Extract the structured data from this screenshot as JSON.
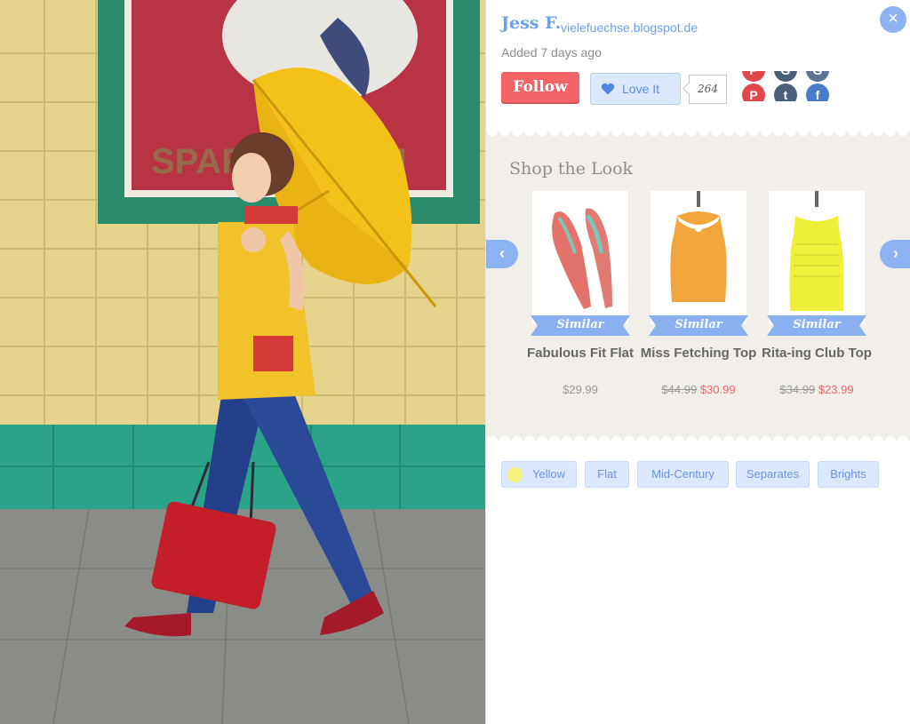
{
  "user": {
    "name": "Jess F.",
    "blog": "vielefuechse.blogspot.de",
    "added": "Added 7 days ago"
  },
  "actions": {
    "follow_label": "Follow",
    "love_label": "Love It",
    "love_count": "264",
    "close_label": "×"
  },
  "share": [
    {
      "name": "pinterest-icon",
      "glyph": "P",
      "color": "#e0474c"
    },
    {
      "name": "google-plus-icon",
      "glyph": "G",
      "color": "#4a5f79"
    },
    {
      "name": "google-plus-icon",
      "glyph": "G",
      "color": "#5b7494"
    },
    {
      "name": "pinterest-icon",
      "glyph": "P",
      "color": "#e0474c"
    },
    {
      "name": "tumblr-icon",
      "glyph": "t",
      "color": "#4a5f79"
    },
    {
      "name": "facebook-icon",
      "glyph": "f",
      "color": "#4a7dc9"
    }
  ],
  "shop": {
    "title": "Shop the Look",
    "prev_label": "‹",
    "next_label": "›",
    "similar_label": "Similar",
    "products": [
      {
        "name": "Fabulous Fit Flat",
        "old_price": "",
        "price": "$29.99",
        "image": "coral-flat-shoe"
      },
      {
        "name": "Miss Fetching Top",
        "old_price": "$44.99",
        "price": "$30.99",
        "image": "mustard-top"
      },
      {
        "name": "Rita-ing Club Top",
        "old_price": "$34.99",
        "price": "$23.99",
        "image": "lime-top"
      }
    ]
  },
  "tags": [
    "Yellow",
    "Flat",
    "Mid-Century",
    "Separates",
    "Brights"
  ],
  "colors": {
    "accent_blue": "#6d9ef0",
    "follow_red": "#f26467",
    "tag_bg": "#dce8fd",
    "shop_bg": "#f2efea"
  }
}
